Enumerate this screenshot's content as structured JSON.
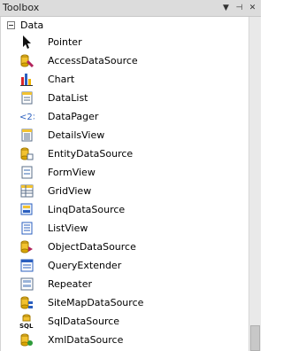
{
  "window": {
    "title": "Toolbox",
    "controls": [
      "▼",
      "⊣",
      "✕"
    ]
  },
  "group": {
    "label": "Data"
  },
  "items": [
    {
      "label": "Pointer",
      "icon": "pointer-icon"
    },
    {
      "label": "AccessDataSource",
      "icon": "access-datasource-icon"
    },
    {
      "label": "Chart",
      "icon": "chart-icon"
    },
    {
      "label": "DataList",
      "icon": "datalist-icon"
    },
    {
      "label": "DataPager",
      "icon": "datapager-icon"
    },
    {
      "label": "DetailsView",
      "icon": "detailsview-icon"
    },
    {
      "label": "EntityDataSource",
      "icon": "entity-datasource-icon"
    },
    {
      "label": "FormView",
      "icon": "formview-icon"
    },
    {
      "label": "GridView",
      "icon": "gridview-icon"
    },
    {
      "label": "LinqDataSource",
      "icon": "linq-datasource-icon"
    },
    {
      "label": "ListView",
      "icon": "listview-icon"
    },
    {
      "label": "ObjectDataSource",
      "icon": "object-datasource-icon"
    },
    {
      "label": "QueryExtender",
      "icon": "query-extender-icon"
    },
    {
      "label": "Repeater",
      "icon": "repeater-icon"
    },
    {
      "label": "SiteMapDataSource",
      "icon": "sitemap-datasource-icon"
    },
    {
      "label": "SqlDataSource",
      "icon": "sql-datasource-icon"
    },
    {
      "label": "XmlDataSource",
      "icon": "xml-datasource-icon"
    }
  ],
  "colors": {
    "titlebar": "#dcdcdc",
    "background": "#ffffff"
  }
}
